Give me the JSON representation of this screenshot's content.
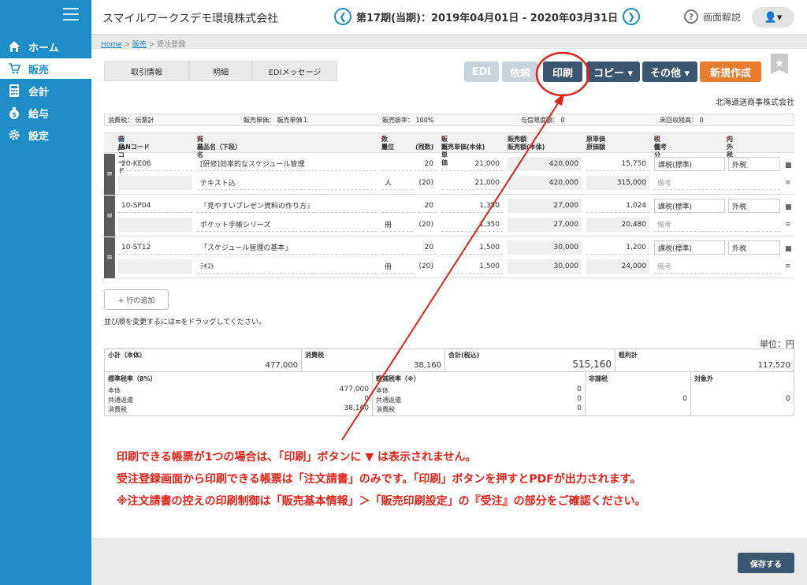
{
  "sidebar": {
    "items": [
      {
        "label": "ホーム",
        "icon": "home-icon"
      },
      {
        "label": "販売",
        "icon": "cart-icon"
      },
      {
        "label": "会計",
        "icon": "calculator-icon"
      },
      {
        "label": "給与",
        "icon": "money-bag-icon"
      },
      {
        "label": "設定",
        "icon": "gear-icon"
      }
    ],
    "active": 1
  },
  "header": {
    "company": "スマイルワークスデモ環境株式会社",
    "period": "第17期(当期)：2019年04月01日 - 2020年03月31日",
    "prev": "❮",
    "next": "❯",
    "help": "画面解説",
    "user": "👤▾"
  },
  "breadcrumb": {
    "home": "Home",
    "sales": "販売",
    "sep": " > ",
    "current": "受注登録"
  },
  "tabs": [
    "取引情報",
    "明細",
    "EDIメッセージ"
  ],
  "toolbar": {
    "edi": "EDI",
    "request": "依頼",
    "print": "印刷",
    "copy": "コピー ▾",
    "other": "その他 ▾",
    "new": "新規作成",
    "star": "★"
  },
  "customer": "北海道送商事株式会社",
  "info": {
    "tax": "消費税：  伝票計",
    "price": "販売単価：  販売単価１",
    "rate": "販売掛率：  100%",
    "credit": "与信限度額：  0",
    "receivable": "未回収残高：  0"
  },
  "grid": {
    "headers": {
      "code": "商品コード",
      "jan": "JANコード",
      "name": "商品名",
      "name2": "商品名（下段）",
      "qty": "数量",
      "unit": "単位",
      "cases": "(残数)",
      "price": "販売単価",
      "price2": "販売単価(本体)",
      "amount": "販売額",
      "amount2": "販売額(本体)",
      "cost": "原単価",
      "cost2": "原価額",
      "taxcls": "税区分",
      "memo": "備考",
      "inout": "内外税"
    },
    "rows": [
      {
        "code": "20-KE06",
        "name": "[研修]効率的なスケジュール管理",
        "name2": "テキスト込",
        "qty": "20",
        "unit": "人",
        "remain": "(20)",
        "price": "21,000",
        "price2": "21,000",
        "amount": "420,000",
        "amount2": "420,000",
        "cost": "15,750",
        "costamt": "315,000",
        "taxcls": "課税(標準)",
        "inout": "外税",
        "memo": "備考"
      },
      {
        "code": "10-SP04",
        "name": "『見やすいプレゼン資料の作り方』",
        "name2": "ポケット手帳シリーズ",
        "qty": "20",
        "unit": "冊",
        "remain": "(20)",
        "price": "1,350",
        "price2": "1,350",
        "amount": "27,000",
        "amount2": "27,000",
        "cost": "1,024",
        "costamt": "20,480",
        "taxcls": "課税(標準)",
        "inout": "外税",
        "memo": "備考"
      },
      {
        "code": "10-ST12",
        "name": "「スケジュール管理の基本」",
        "name2": "ﾃｷｽﾄ",
        "qty": "20",
        "unit": "冊",
        "remain": "(20)",
        "price": "1,500",
        "price2": "1,500",
        "amount": "30,000",
        "amount2": "30,000",
        "cost": "1,200",
        "costamt": "24,000",
        "taxcls": "課税(標準)",
        "inout": "外税",
        "memo": "備考"
      }
    ]
  },
  "add_row": "+ 行の追加",
  "drag_note": "並び順を変更するには≡をドラッグしてください。",
  "unit_label": "単位：円",
  "totals": {
    "subtotal_label": "小計（本体）",
    "subtotal": "477,000",
    "tax_label": "消費税",
    "tax": "38,160",
    "total_label": "合計(税込)",
    "total": "515,160",
    "gross_label": "粗利計",
    "gross": "117,520"
  },
  "taxbreak": {
    "std_label": "標準税率（8%）",
    "reduced_label": "軽減税率（※）",
    "exempt_label": "非課税",
    "nontax_label": "対象外",
    "lines": [
      "本体",
      "共通返還",
      "消費税"
    ],
    "std_values": [
      "477,000",
      "0",
      "38,160"
    ],
    "reduced_values": [
      "0",
      "0",
      "0"
    ],
    "exempt_value": "0",
    "nontax_value": "0"
  },
  "notes": [
    "印刷できる帳票が1つの場合は、「印刷」ボタンに ▼ は表示されません。",
    "受注登録画面から印刷できる帳票は「注文請書」のみです。「印刷」ボタンを押すとPDFが出力されます。",
    "※注文請書の控えの印刷制御は「販売基本情報」＞「販売印刷設定」の『受注』の部分をご確認ください。"
  ],
  "save": "保存する"
}
